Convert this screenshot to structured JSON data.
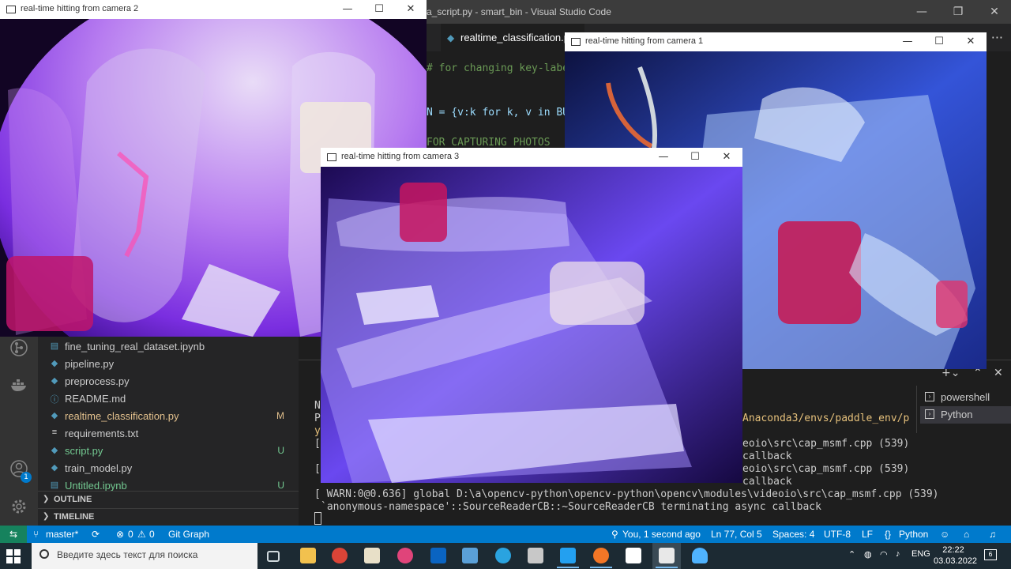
{
  "vscode": {
    "window_title": "a_script.py - smart_bin - Visual Studio Code",
    "window_controls": [
      "—",
      "❐",
      "✕"
    ],
    "active_tab": "realtime_classification.py",
    "code_lines": [
      {
        "text": "# for changing key-labels"
      },
      {
        "text": "N = {v:k for k, v in BU"
      },
      {
        "text": "FOR CAPTURING PHOTOS"
      }
    ],
    "explorer_files": [
      {
        "name": "fine_tuning_real_dataset.ipynb",
        "icon": "list-icon",
        "status": "",
        "kind": "normal"
      },
      {
        "name": "pipeline.py",
        "icon": "python-icon",
        "status": "",
        "kind": "normal"
      },
      {
        "name": "preprocess.py",
        "icon": "python-icon",
        "status": "",
        "kind": "normal"
      },
      {
        "name": "README.md",
        "icon": "info-icon",
        "status": "",
        "kind": "normal"
      },
      {
        "name": "realtime_classification.py",
        "icon": "python-icon",
        "status": "M",
        "kind": "mod"
      },
      {
        "name": "requirements.txt",
        "icon": "lines-icon",
        "status": "",
        "kind": "normal"
      },
      {
        "name": "script.py",
        "icon": "python-icon",
        "status": "U",
        "kind": "untr"
      },
      {
        "name": "train_model.py",
        "icon": "python-icon",
        "status": "",
        "kind": "normal"
      },
      {
        "name": "Untitled.ipynb",
        "icon": "list-icon",
        "status": "U",
        "kind": "untr"
      }
    ],
    "sections": {
      "outline": "OUTLINE",
      "timeline": "TIMELINE"
    },
    "accounts_badge": "1",
    "terminal": {
      "lines": [
        {
          "text": "N",
          "y": 0
        },
        {
          "text": "P",
          "y": 0
        },
        {
          "text": "y",
          "y": 0
        }
      ],
      "right_lines": [
        {
          "text": "Anaconda3/envs/paddle_env/p",
          "yellow": true
        },
        {
          "text": "eoio\\src\\cap_msmf.cpp (539)",
          "yellow": false
        },
        {
          "text": "callback",
          "yellow": false
        },
        {
          "text": "eoio\\src\\cap_msmf.cpp (539)",
          "yellow": false
        },
        {
          "text": "callback",
          "yellow": false
        }
      ],
      "warn_line": "[ WARN:0@0.636] global D:\\a\\opencv-python\\opencv-python\\opencv\\modules\\videoio\\src\\cap_msmf.cpp (539)",
      "warn_line2": "`anonymous-namespace'::SourceReaderCB::~SourceReaderCB terminating async callback",
      "sessions": [
        "powershell",
        "Python"
      ],
      "selected_session": "Python"
    },
    "status": {
      "branch": "master*",
      "errors": "0",
      "warnings": "0",
      "git_graph": "Git Graph",
      "blame": "You, 1 second ago",
      "position": "Ln 77, Col 5",
      "spaces": "Spaces: 4",
      "encoding": "UTF-8",
      "eol": "LF",
      "language": "Python"
    }
  },
  "cv_windows": [
    {
      "title": "real-time hitting from camera 2"
    },
    {
      "title": "real-time hitting from camera 1"
    },
    {
      "title": "real-time hitting from camera 3"
    }
  ],
  "taskbar": {
    "search_placeholder": "Введите здесь текст для поиска",
    "language": "ENG",
    "time": "22:22",
    "date": "03.03.2022",
    "notifications": "6",
    "apps": [
      "task-view-icon",
      "file-explorer-icon",
      "chrome-icon",
      "files-icon",
      "slack-icon",
      "outlook-icon",
      "network-icon",
      "telegram-icon",
      "tool-icon",
      "vscode-icon",
      "jupyter-icon",
      "notion-icon",
      "window-icon",
      "cloud-icon"
    ]
  },
  "colors": {
    "accent": "#007acc",
    "remote": "#16825d",
    "taskbar": "#1c2a33"
  }
}
